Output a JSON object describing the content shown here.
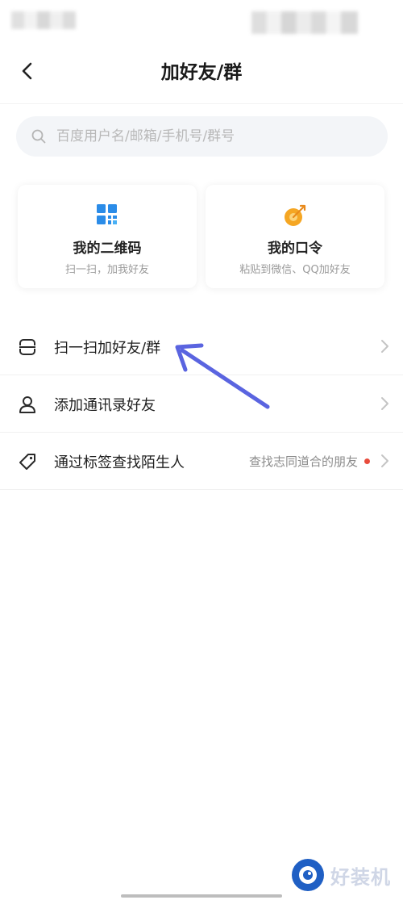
{
  "header": {
    "title": "加好友/群"
  },
  "search": {
    "placeholder": "百度用户名/邮箱/手机号/群号"
  },
  "cards": [
    {
      "title": "我的二维码",
      "subtitle": "扫一扫，加我好友",
      "icon": "qr-code-icon"
    },
    {
      "title": "我的口令",
      "subtitle": "粘贴到微信、QQ加好友",
      "icon": "target-icon"
    }
  ],
  "list": [
    {
      "label": "扫一扫加好友/群",
      "icon": "scan-icon"
    },
    {
      "label": "添加通讯录好友",
      "icon": "contact-icon"
    },
    {
      "label": "通过标签查找陌生人",
      "icon": "tag-icon",
      "hint": "查找志同道合的朋友"
    }
  ],
  "watermark": {
    "text": "好装机"
  },
  "colors": {
    "accent_blue": "#2b8ce8",
    "accent_orange": "#f5a623",
    "annotation": "#5a64e0",
    "badge_red": "#e84b3c"
  }
}
